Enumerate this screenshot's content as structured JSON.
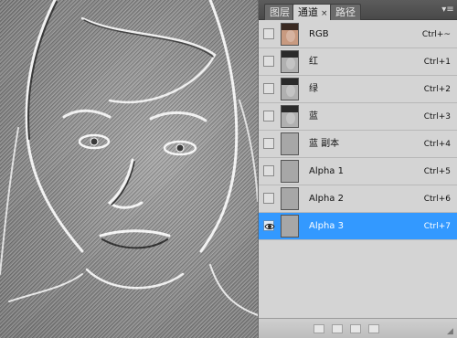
{
  "tabs": [
    {
      "label": "图层",
      "active": false
    },
    {
      "label": "通道",
      "active": true,
      "close": "×"
    },
    {
      "label": "路径",
      "active": false
    }
  ],
  "panel_menu_icon": "▾≡",
  "channels": [
    {
      "name": "RGB",
      "shortcut": "Ctrl+~",
      "thumb": "photo",
      "visible": false,
      "selected": false
    },
    {
      "name": "红",
      "shortcut": "Ctrl+1",
      "thumb": "gray",
      "visible": false,
      "selected": false
    },
    {
      "name": "绿",
      "shortcut": "Ctrl+2",
      "thumb": "gray",
      "visible": false,
      "selected": false
    },
    {
      "name": "蓝",
      "shortcut": "Ctrl+3",
      "thumb": "gray",
      "visible": false,
      "selected": false
    },
    {
      "name": "蓝 副本",
      "shortcut": "Ctrl+4",
      "thumb": "plain",
      "visible": false,
      "selected": false
    },
    {
      "name": "Alpha 1",
      "shortcut": "Ctrl+5",
      "thumb": "plain",
      "visible": false,
      "selected": false
    },
    {
      "name": "Alpha 2",
      "shortcut": "Ctrl+6",
      "thumb": "plain",
      "visible": false,
      "selected": false
    },
    {
      "name": "Alpha 3",
      "shortcut": "Ctrl+7",
      "thumb": "plain",
      "visible": true,
      "selected": true
    }
  ],
  "colors": {
    "selection": "#3399ff",
    "panel_bg": "#d4d4d4",
    "tabbar_bg": "#494949"
  },
  "icons": {
    "visibility": "eye-icon",
    "menu": "panel-menu-icon"
  }
}
